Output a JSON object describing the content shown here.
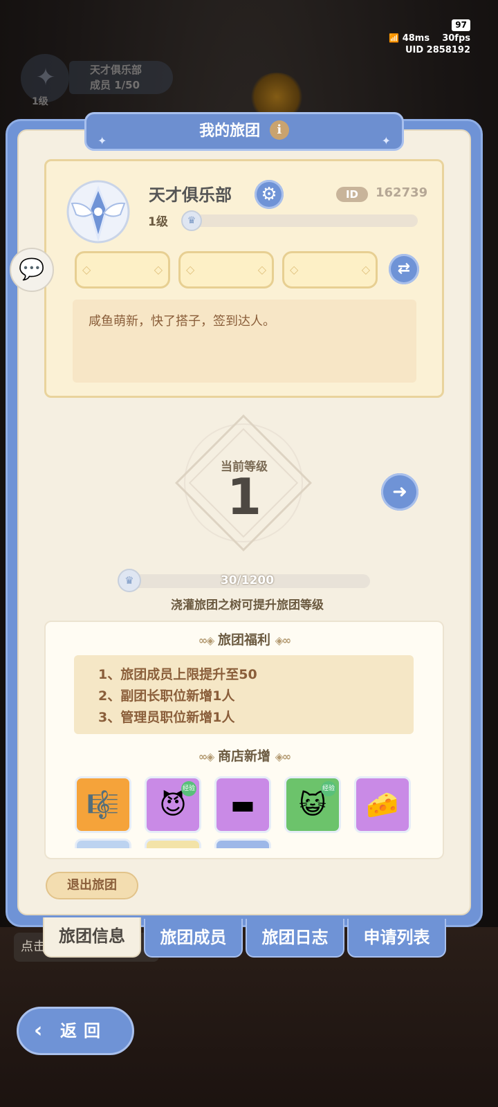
{
  "status": {
    "battery": "97",
    "latency": "48ms",
    "fps": "30fps",
    "uid_label": "UID",
    "uid": "2858192"
  },
  "background_badge": {
    "name": "天才俱乐部",
    "members": "成员   1/50",
    "level": "1级"
  },
  "header": {
    "title": "我的旅团",
    "info_icon": "i"
  },
  "club": {
    "name": "天才俱乐部",
    "id_label": "ID",
    "id": "162739",
    "level": "1级",
    "exp_progress": 0.0,
    "description": "咸鱼萌新，快了搭子，签到达人。"
  },
  "current_level": {
    "label": "当前等级",
    "value": "1",
    "progress_text": "30/1200",
    "progress": 0.025,
    "hint": "浇灌旅团之树可提升旅团等级"
  },
  "benefits": {
    "title": "旅团福利",
    "items": [
      "1、旅团成员上限提升至50",
      "2、副团长职位新增1人",
      "3、管理员职位新增1人"
    ]
  },
  "shop": {
    "title": "商店新增",
    "items": [
      {
        "icon": "lyre-icon",
        "glyph": "🎼",
        "bg": "#f5a33a",
        "tag": ""
      },
      {
        "icon": "purple-spirit-icon",
        "glyph": "😈",
        "bg": "#c98ae6",
        "tag": "经验"
      },
      {
        "icon": "iron-ingot-icon",
        "glyph": "▬",
        "bg": "#c98ae6",
        "tag": ""
      },
      {
        "icon": "green-spirit-icon",
        "glyph": "😺",
        "bg": "#6cc36b",
        "tag": "经验"
      },
      {
        "icon": "cheese-icon",
        "glyph": "🧀",
        "bg": "#c98ae6",
        "tag": ""
      }
    ]
  },
  "actions": {
    "quit": "退出旅团"
  },
  "tabs": [
    "旅团信息",
    "旅团成员",
    "旅团日志",
    "申请列表"
  ],
  "background_hint": "点击",
  "back": {
    "label": "返回"
  }
}
